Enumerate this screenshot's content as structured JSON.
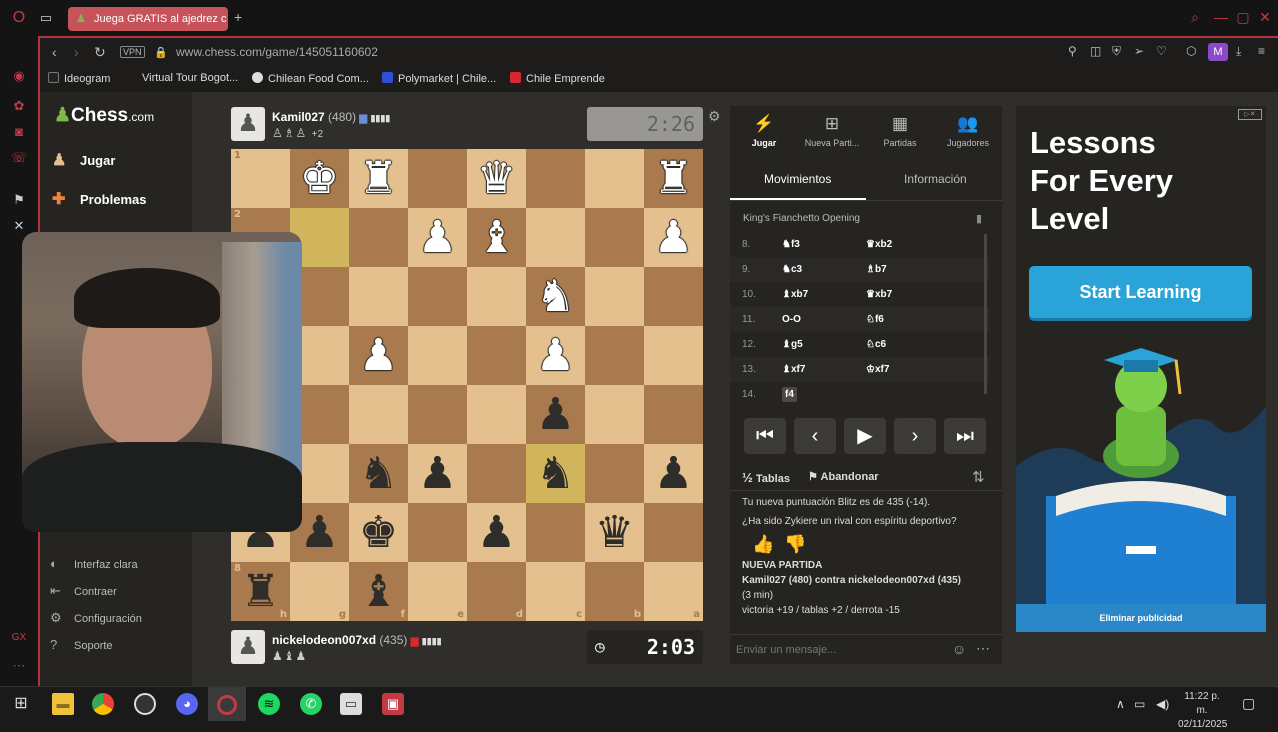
{
  "browser": {
    "tab_title": "Juega GRATIS al ajedrez c",
    "url": "www.chess.com/game/145051160602",
    "vpn_label": "VPN",
    "profile_initial": "M",
    "bookmarks": [
      {
        "label": "Ideogram",
        "color": "#222222"
      },
      {
        "label": "Virtual Tour Bogot...",
        "color": "#444444"
      },
      {
        "label": "Chilean Food Com...",
        "color": "#dddddd"
      },
      {
        "label": "Polymarket | Chile...",
        "color": "#2f4fd6"
      },
      {
        "label": "Chile Emprende",
        "color": "#d8282f"
      }
    ]
  },
  "nav": {
    "logo_main": "Chess",
    "logo_domain": ".com",
    "items": [
      {
        "label": "Jugar",
        "icon": "play-icon"
      },
      {
        "label": "Problemas",
        "icon": "puzzle-icon"
      }
    ],
    "bottom": [
      {
        "label": "Interfaz clara",
        "icon": "theme-icon"
      },
      {
        "label": "Contraer",
        "icon": "collapse-icon"
      },
      {
        "label": "Configuración",
        "icon": "gear-icon"
      },
      {
        "label": "Soporte",
        "icon": "help-icon"
      }
    ]
  },
  "game": {
    "top_player": {
      "name": "Kamil027",
      "rating": "(480)",
      "captured": "♙♗♙",
      "advantage": "+2",
      "clock": "2:26"
    },
    "bottom_player": {
      "name": "nickelodeon007xd",
      "rating": "(435)",
      "captured": "♟♝♟",
      "clock": "2:03"
    },
    "ranks": [
      "1",
      "2",
      "3",
      "4",
      "5",
      "6",
      "7",
      "8"
    ],
    "files": [
      "h",
      "g",
      "f",
      "e",
      "d",
      "c",
      "b",
      "a"
    ],
    "board": [
      [
        "",
        "wK",
        "wR",
        "",
        "wQ",
        "",
        "",
        "wR"
      ],
      [
        "",
        "",
        "",
        "wP",
        "wB",
        "",
        "",
        "wP"
      ],
      [
        "wP",
        "",
        "",
        "",
        "",
        "wN",
        "",
        ""
      ],
      [
        "",
        "",
        "wP",
        "",
        "",
        "wP",
        "",
        ""
      ],
      [
        "",
        "",
        "",
        "",
        "",
        "bP",
        "",
        ""
      ],
      [
        "",
        "",
        "bN",
        "bP",
        "",
        "bN",
        "",
        "bP"
      ],
      [
        "bP",
        "bP",
        "bK",
        "",
        "bP",
        "",
        "bQ",
        ""
      ],
      [
        "bR",
        "",
        "bB",
        "",
        "",
        "",
        "",
        ""
      ]
    ],
    "highlight": [
      [
        5,
        5
      ],
      [
        1,
        1
      ]
    ]
  },
  "panel": {
    "tabs": [
      {
        "label": "Jugar",
        "icon": "bolt-icon"
      },
      {
        "label": "Nueva Parti...",
        "icon": "plus-icon"
      },
      {
        "label": "Partidas",
        "icon": "board-icon"
      },
      {
        "label": "Jugadores",
        "icon": "users-icon"
      }
    ],
    "subtabs": [
      "Movimientos",
      "Información"
    ],
    "opening": "King's Fianchetto Opening",
    "moves": [
      {
        "num": "8.",
        "w": "♞f3",
        "b": "♛xb2"
      },
      {
        "num": "9.",
        "w": "♞c3",
        "b": "♗b7"
      },
      {
        "num": "10.",
        "w": "♝xb7",
        "b": "♛xb7"
      },
      {
        "num": "11.",
        "w": "O-O",
        "b": "♘f6"
      },
      {
        "num": "12.",
        "w": "♝g5",
        "b": "♘c6"
      },
      {
        "num": "13.",
        "w": "♝xf7",
        "b": "♔xf7"
      },
      {
        "num": "14.",
        "w": "f4",
        "b": ""
      }
    ],
    "actions": {
      "draw": "Tablas",
      "resign": "Abandonar"
    },
    "chat": [
      "Tu nueva puntuación Blitz es de 435 (-14).",
      "¿Ha sido Zykiere un rival con espíritu deportivo?",
      "NUEVA PARTIDA",
      "Kamil027 (480) contra nickelodeon007xd (435)",
      "(3 min)",
      "victoria +19 / tablas +2 / derrota -15"
    ],
    "chat_placeholder": "Enviar un mensaje..."
  },
  "ad": {
    "title_lines": [
      "Lessons",
      "For Every",
      "Level"
    ],
    "button": "Start Learning",
    "remove": "Eliminar publicidad"
  },
  "taskbar": {
    "time": "11:22 p. m.",
    "date": "02/11/2025"
  }
}
